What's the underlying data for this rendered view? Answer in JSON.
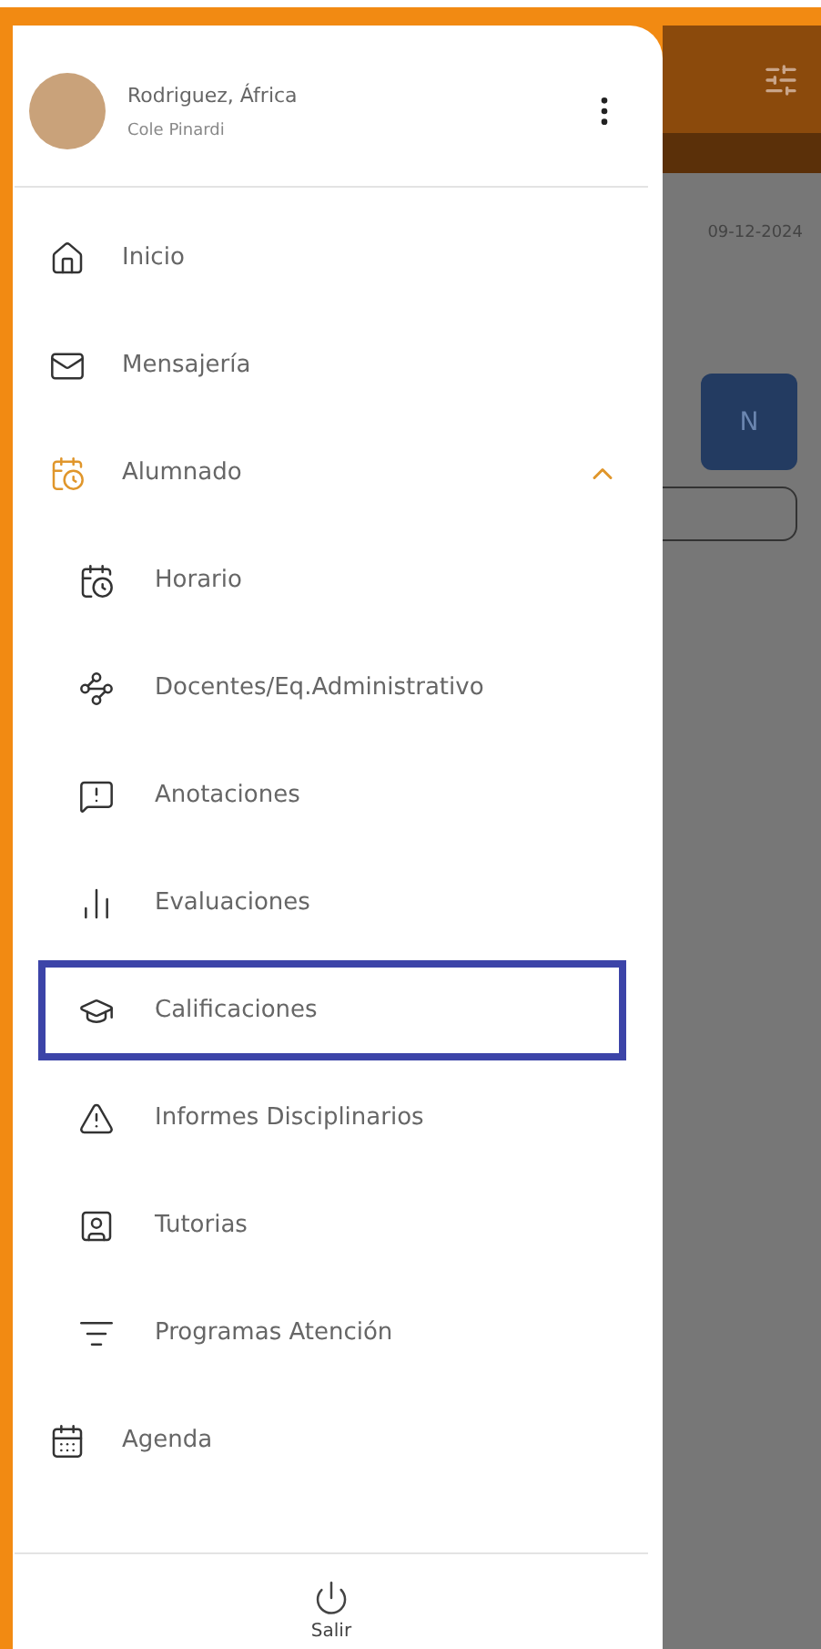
{
  "profile": {
    "name": "Rodriguez, África",
    "subtitle": "Cole Pinardi"
  },
  "menu": [
    {
      "label": "Inicio",
      "selected": false
    },
    {
      "label": "Mensajería",
      "selected": false
    },
    {
      "label": "Alumnado",
      "selected": false,
      "expanded": true,
      "children": [
        {
          "label": "Horario",
          "selected": false
        },
        {
          "label": "Docentes/Eq.Administrativo",
          "selected": false
        },
        {
          "label": "Anotaciones",
          "selected": false
        },
        {
          "label": "Evaluaciones",
          "selected": false
        },
        {
          "label": "Calificaciones",
          "selected": true
        },
        {
          "label": "Informes Disciplinarios",
          "selected": false
        },
        {
          "label": "Tutorias",
          "selected": false
        },
        {
          "label": "Programas Atención",
          "selected": false
        }
      ]
    },
    {
      "label": "Agenda",
      "selected": false
    }
  ],
  "logout": {
    "label": "Salir"
  },
  "background": {
    "date": "09-12-2024",
    "button": "N"
  }
}
